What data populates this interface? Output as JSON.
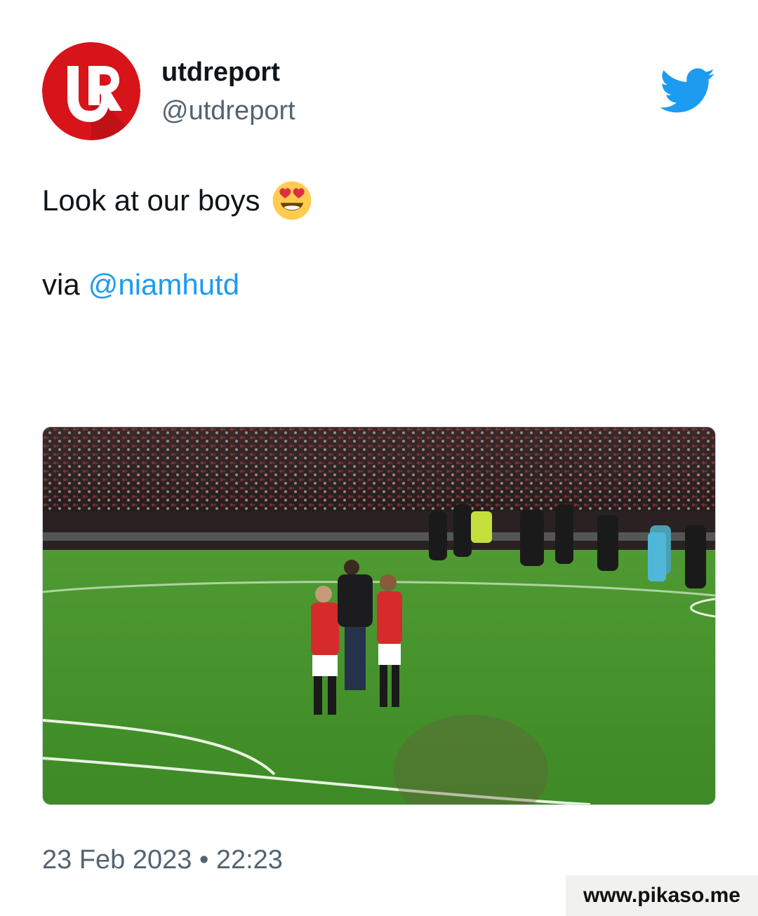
{
  "author": {
    "display_name": "utdreport",
    "handle": "@utdreport",
    "avatar_icon": "utd-report-logo",
    "avatar_color": "#d7141a"
  },
  "brand": {
    "icon": "twitter-bird-icon",
    "color": "#1d9bf0"
  },
  "tweet": {
    "text_line1": "Look at our boys",
    "emoji": "smiling-face-with-heart-eyes",
    "via_prefix": "via",
    "mention": "@niamhutd"
  },
  "media": {
    "type": "image",
    "subject": "football-players-celebrating-on-pitch"
  },
  "timestamp": "23 Feb 2023 • 22:23",
  "watermark": "www.pikaso.me"
}
